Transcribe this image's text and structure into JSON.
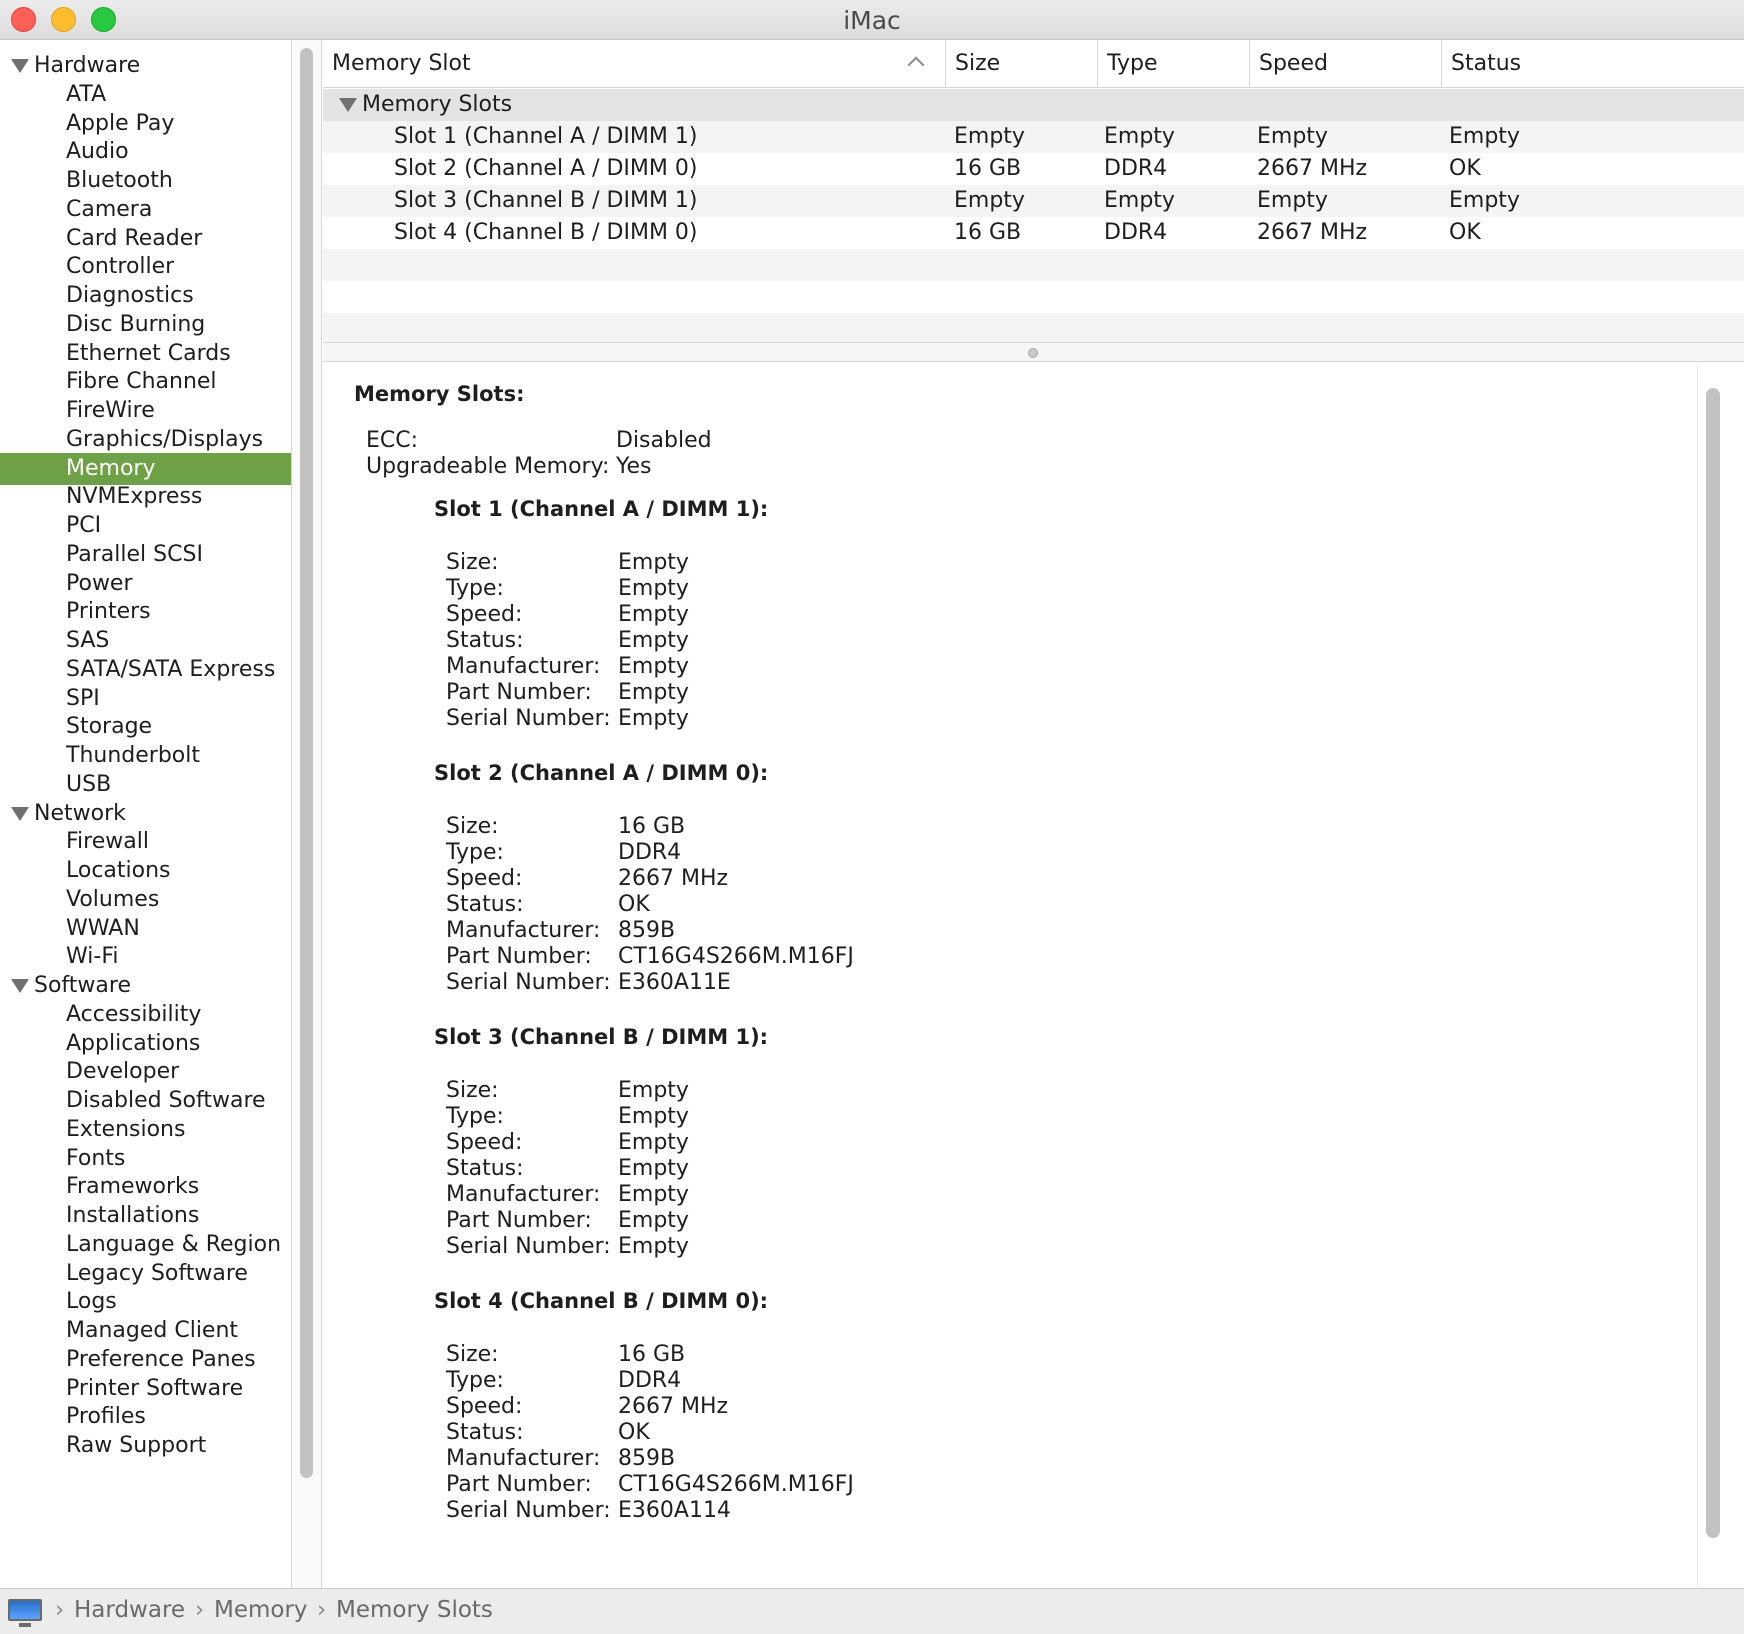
{
  "window": {
    "title": "iMac"
  },
  "sidebar": {
    "items": [
      {
        "label": "Hardware",
        "group": true
      },
      {
        "label": "ATA"
      },
      {
        "label": "Apple Pay"
      },
      {
        "label": "Audio"
      },
      {
        "label": "Bluetooth"
      },
      {
        "label": "Camera"
      },
      {
        "label": "Card Reader"
      },
      {
        "label": "Controller"
      },
      {
        "label": "Diagnostics"
      },
      {
        "label": "Disc Burning"
      },
      {
        "label": "Ethernet Cards"
      },
      {
        "label": "Fibre Channel"
      },
      {
        "label": "FireWire"
      },
      {
        "label": "Graphics/Displays"
      },
      {
        "label": "Memory",
        "selected": true
      },
      {
        "label": "NVMExpress"
      },
      {
        "label": "PCI"
      },
      {
        "label": "Parallel SCSI"
      },
      {
        "label": "Power"
      },
      {
        "label": "Printers"
      },
      {
        "label": "SAS"
      },
      {
        "label": "SATA/SATA Express"
      },
      {
        "label": "SPI"
      },
      {
        "label": "Storage"
      },
      {
        "label": "Thunderbolt"
      },
      {
        "label": "USB"
      },
      {
        "label": "Network",
        "group": true
      },
      {
        "label": "Firewall"
      },
      {
        "label": "Locations"
      },
      {
        "label": "Volumes"
      },
      {
        "label": "WWAN"
      },
      {
        "label": "Wi-Fi"
      },
      {
        "label": "Software",
        "group": true
      },
      {
        "label": "Accessibility"
      },
      {
        "label": "Applications"
      },
      {
        "label": "Developer"
      },
      {
        "label": "Disabled Software"
      },
      {
        "label": "Extensions"
      },
      {
        "label": "Fonts"
      },
      {
        "label": "Frameworks"
      },
      {
        "label": "Installations"
      },
      {
        "label": "Language & Region"
      },
      {
        "label": "Legacy Software"
      },
      {
        "label": "Logs"
      },
      {
        "label": "Managed Client"
      },
      {
        "label": "Preference Panes"
      },
      {
        "label": "Printer Software"
      },
      {
        "label": "Profiles"
      },
      {
        "label": "Raw Support"
      }
    ]
  },
  "table": {
    "columns": [
      "Memory Slot",
      "Size",
      "Type",
      "Speed",
      "Status"
    ],
    "group_label": "Memory Slots",
    "rows": [
      [
        "Slot 1 (Channel A / DIMM 1)",
        "Empty",
        "Empty",
        "Empty",
        "Empty"
      ],
      [
        "Slot 2 (Channel A / DIMM 0)",
        "16 GB",
        "DDR4",
        "2667 MHz",
        "OK"
      ],
      [
        "Slot 3 (Channel B / DIMM 1)",
        "Empty",
        "Empty",
        "Empty",
        "Empty"
      ],
      [
        "Slot 4 (Channel B / DIMM 0)",
        "16 GB",
        "DDR4",
        "2667 MHz",
        "OK"
      ]
    ]
  },
  "detail": {
    "title": "Memory Slots:",
    "summary": [
      {
        "key": "ECC:",
        "value": "Disabled"
      },
      {
        "key": "Upgradeable Memory:",
        "value": "Yes"
      }
    ],
    "slots": [
      {
        "title": "Slot 1 (Channel A / DIMM 1):",
        "fields": [
          {
            "key": "Size:",
            "value": "Empty"
          },
          {
            "key": "Type:",
            "value": "Empty"
          },
          {
            "key": "Speed:",
            "value": "Empty"
          },
          {
            "key": "Status:",
            "value": "Empty"
          },
          {
            "key": "Manufacturer:",
            "value": "Empty"
          },
          {
            "key": "Part Number:",
            "value": "Empty"
          },
          {
            "key": "Serial Number:",
            "value": "Empty"
          }
        ]
      },
      {
        "title": "Slot 2 (Channel A / DIMM 0):",
        "fields": [
          {
            "key": "Size:",
            "value": "16 GB"
          },
          {
            "key": "Type:",
            "value": "DDR4"
          },
          {
            "key": "Speed:",
            "value": "2667 MHz"
          },
          {
            "key": "Status:",
            "value": "OK"
          },
          {
            "key": "Manufacturer:",
            "value": "859B"
          },
          {
            "key": "Part Number:",
            "value": "CT16G4S266M.M16FJ"
          },
          {
            "key": "Serial Number:",
            "value": "E360A11E"
          }
        ]
      },
      {
        "title": "Slot 3 (Channel B / DIMM 1):",
        "fields": [
          {
            "key": "Size:",
            "value": "Empty"
          },
          {
            "key": "Type:",
            "value": "Empty"
          },
          {
            "key": "Speed:",
            "value": "Empty"
          },
          {
            "key": "Status:",
            "value": "Empty"
          },
          {
            "key": "Manufacturer:",
            "value": "Empty"
          },
          {
            "key": "Part Number:",
            "value": "Empty"
          },
          {
            "key": "Serial Number:",
            "value": "Empty"
          }
        ]
      },
      {
        "title": "Slot 4 (Channel B / DIMM 0):",
        "fields": [
          {
            "key": "Size:",
            "value": "16 GB"
          },
          {
            "key": "Type:",
            "value": "DDR4"
          },
          {
            "key": "Speed:",
            "value": "2667 MHz"
          },
          {
            "key": "Status:",
            "value": "OK"
          },
          {
            "key": "Manufacturer:",
            "value": "859B"
          },
          {
            "key": "Part Number:",
            "value": "CT16G4S266M.M16FJ"
          },
          {
            "key": "Serial Number:",
            "value": "E360A114"
          }
        ]
      }
    ]
  },
  "pathbar": {
    "icon": "imac-icon",
    "crumbs": [
      "Hardware",
      "Memory",
      "Memory Slots"
    ]
  },
  "colors": {
    "selection": "#6ea046",
    "group_row": "#e3e3e3"
  }
}
